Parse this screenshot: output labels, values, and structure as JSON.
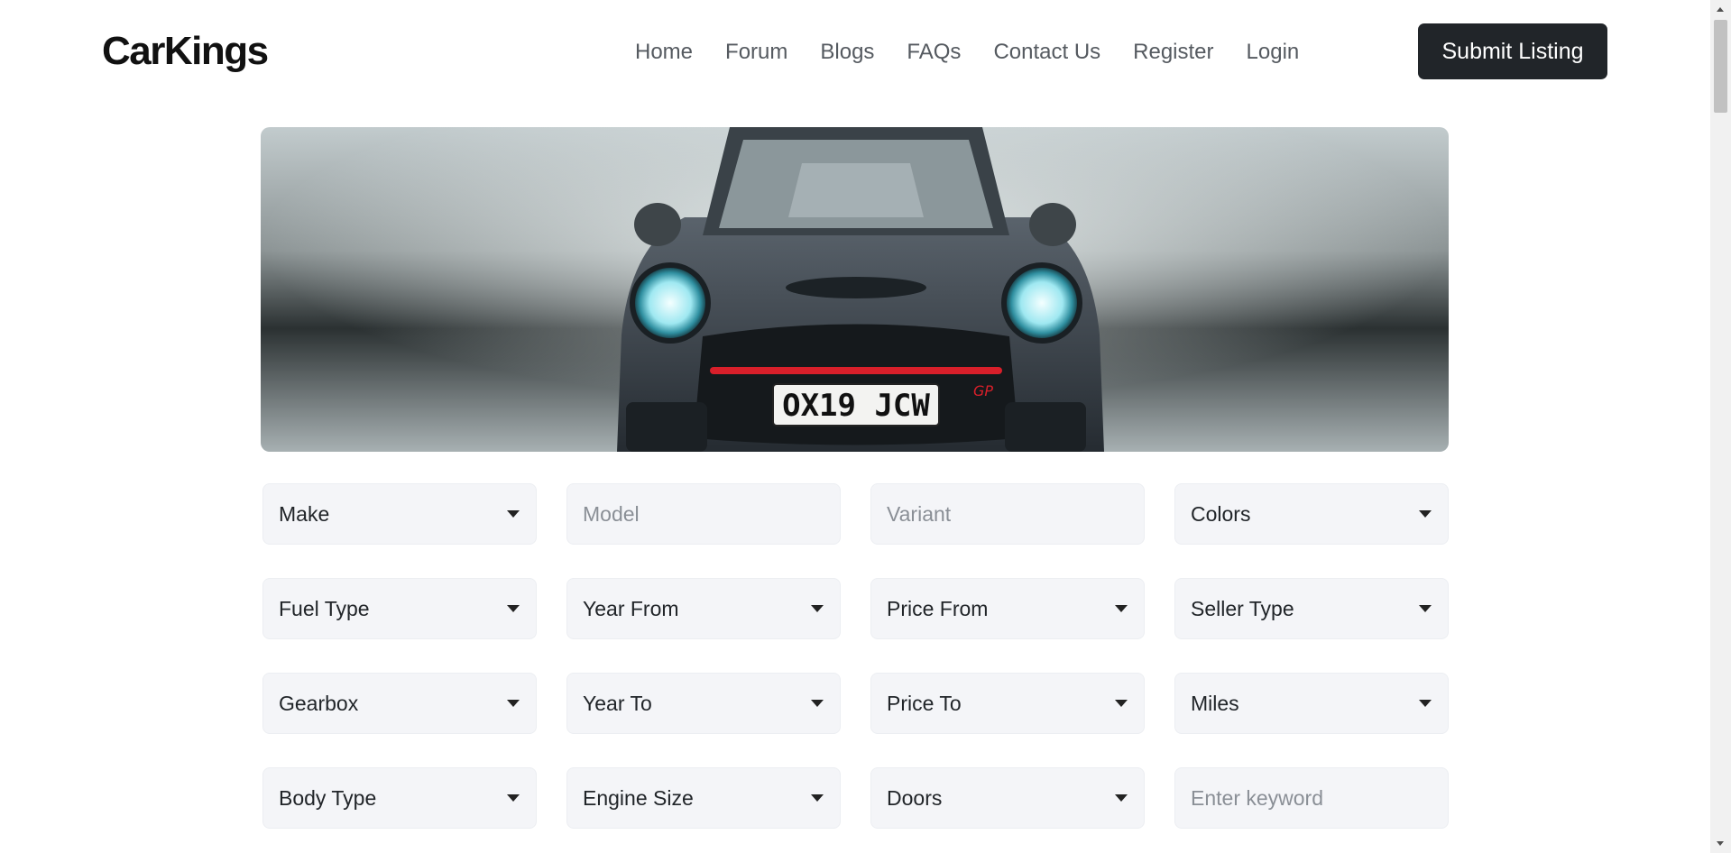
{
  "brand": {
    "name": "CarKings"
  },
  "nav": {
    "links": [
      "Home",
      "Forum",
      "Blogs",
      "FAQs",
      "Contact Us",
      "Register",
      "Login"
    ],
    "submit_label": "Submit Listing"
  },
  "hero": {
    "plate_text": "OX19 JCW",
    "badge_text": "GP"
  },
  "filters": {
    "make": "Make",
    "model_placeholder": "Model",
    "variant_placeholder": "Variant",
    "colors": "Colors",
    "fuel_type": "Fuel Type",
    "year_from": "Year From",
    "price_from": "Price From",
    "seller_type": "Seller Type",
    "gearbox": "Gearbox",
    "year_to": "Year To",
    "price_to": "Price To",
    "miles": "Miles",
    "body_type": "Body Type",
    "engine_size": "Engine Size",
    "doors": "Doors",
    "keyword_placeholder": "Enter keyword"
  },
  "colors": {
    "button_bg": "#212529",
    "field_bg": "#f4f5f8",
    "grille_accent": "#d81f2a"
  }
}
